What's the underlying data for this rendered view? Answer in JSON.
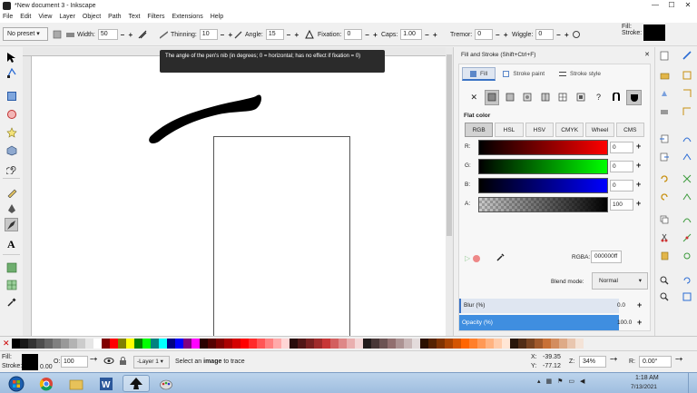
{
  "window": {
    "title": "*New document 3 - Inkscape",
    "minimize": "—",
    "maximize": "☐",
    "close": "✕"
  },
  "menu": [
    "File",
    "Edit",
    "View",
    "Layer",
    "Object",
    "Path",
    "Text",
    "Filters",
    "Extensions",
    "Help"
  ],
  "tool_controls": {
    "preset": "No preset",
    "width_label": "Width:",
    "width": "50",
    "thinning_label": "Thinning:",
    "thinning": "10",
    "angle_label": "Angle:",
    "angle": "15",
    "fixation_label": "Fixation:",
    "fixation": "0",
    "caps_label": "Caps:",
    "caps": "1.00",
    "tremor_label": "Tremor:",
    "tremor": "0",
    "wiggle_label": "Wiggle:",
    "wiggle": "0",
    "fill_label": "Fill:",
    "stroke_label": "Stroke:",
    "stroke_value": "0"
  },
  "tooltip": "The angle of the pen's nib (in degrees; 0 = horizontal; has no effect if fixation = 0)",
  "dock": {
    "title": "Fill and Stroke (Shift+Ctrl+F)",
    "tabs": [
      "Fill",
      "Stroke paint",
      "Stroke style"
    ],
    "paint_buttons": [
      "no-paint",
      "flat-color",
      "linear-gradient",
      "radial-gradient",
      "mesh-gradient",
      "pattern",
      "swatch",
      "unset",
      "fill-rule-evenodd",
      "fill-rule-nonzero"
    ],
    "paint_x": "✕",
    "paint_q": "?",
    "flat_color_label": "Flat color",
    "color_modes": [
      "RGB",
      "HSL",
      "HSV",
      "CMYK",
      "Wheel",
      "CMS"
    ],
    "channels": [
      {
        "label": "R:",
        "value": "0"
      },
      {
        "label": "G:",
        "value": "0"
      },
      {
        "label": "B:",
        "value": "0"
      },
      {
        "label": "A:",
        "value": "100"
      }
    ],
    "rgba_label": "RGBA:",
    "rgba_value": "000000ff",
    "blend_label": "Blend mode:",
    "blend_value": "Normal",
    "blur_label": "Blur (%)",
    "blur_value": "0.0",
    "opacity_label": "Opacity (%)",
    "opacity_value": "100.0"
  },
  "status": {
    "fill_label": "Fill:",
    "stroke_label": "Stroke:",
    "stroke_width": "0.00",
    "opacity_label": "O:",
    "opacity_value": "100",
    "layer": "-Layer 1",
    "message_pre": "Select an ",
    "message_bold": "image",
    "message_post": " to trace",
    "x_label": "X:",
    "x_value": "-39.35",
    "y_label": "Y:",
    "y_value": "-77.12",
    "z_label": "Z:",
    "zoom": "34%",
    "r_label": "R:",
    "rotation": "0.00°"
  },
  "taskbar": {
    "time": "1:18 AM",
    "date": "7/13/2021"
  },
  "colors": {
    "accent": "#3f8ee0",
    "fill": "#000000"
  }
}
